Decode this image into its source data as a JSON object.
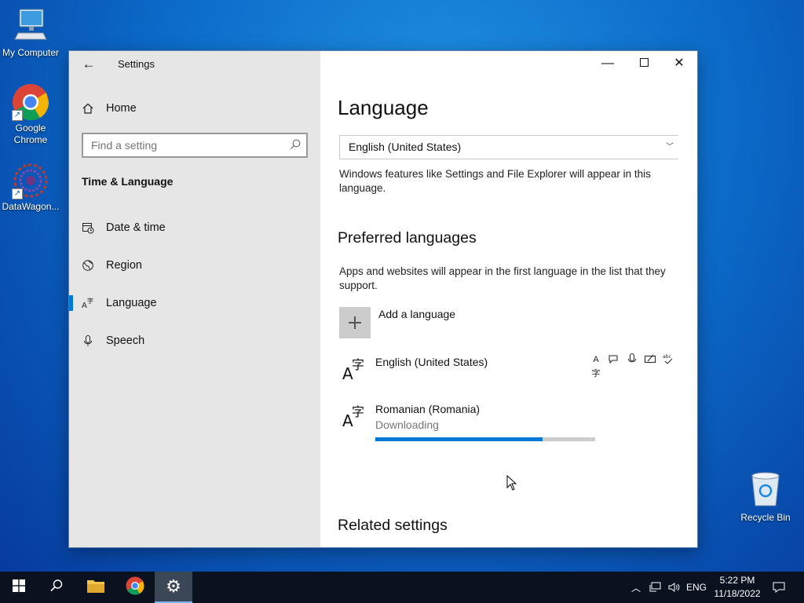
{
  "desktop": {
    "icons": [
      {
        "label": "My Computer"
      },
      {
        "label": "Google Chrome"
      },
      {
        "label": "DataWagon..."
      }
    ],
    "recycle_bin": "Recycle Bin"
  },
  "window": {
    "title": "Settings",
    "back_icon": "back-arrow-icon",
    "caption_buttons": [
      "minimize",
      "maximize",
      "close"
    ]
  },
  "sidebar": {
    "home_label": "Home",
    "search_placeholder": "Find a setting",
    "section_title": "Time & Language",
    "items": [
      {
        "label": "Date & time",
        "icon": "calendar-clock-icon"
      },
      {
        "label": "Region",
        "icon": "globe-icon"
      },
      {
        "label": "Language",
        "icon": "language-icon",
        "active": true
      },
      {
        "label": "Speech",
        "icon": "microphone-icon"
      }
    ]
  },
  "content": {
    "heading": "Language",
    "display_language": "English (United States)",
    "display_language_desc": "Windows features like Settings and File Explorer will appear in this language.",
    "preferred_heading": "Preferred languages",
    "preferred_desc": "Apps and websites will appear in the first language in the list that they support.",
    "add_language_label": "Add a language",
    "languages": [
      {
        "name": "English (United States)",
        "status": "",
        "features": [
          "display-language-icon",
          "speech-icon",
          "microphone-icon",
          "handwriting-icon",
          "spellcheck-icon"
        ]
      },
      {
        "name": "Romanian (Romania)",
        "status": "Downloading",
        "progress": 0.76
      }
    ],
    "related_heading": "Related settings"
  },
  "taskbar": {
    "tray_language": "ENG",
    "time": "5:22 PM",
    "date": "11/18/2022"
  },
  "colors": {
    "accent": "#0078d7",
    "sidebar_bg": "#e6e6e6",
    "taskbar_bg": "#0a1220"
  }
}
